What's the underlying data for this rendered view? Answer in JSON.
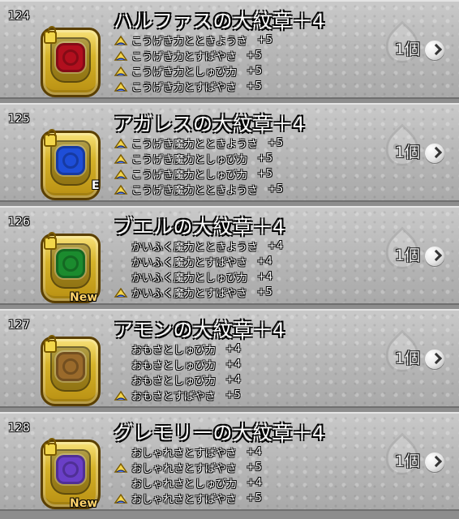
{
  "items": [
    {
      "num": "124",
      "name": "ハルファスの大紋章＋4",
      "qty": "1個",
      "crest_color": "#b10f1e",
      "badge_type": "",
      "stats": [
        {
          "text": "こうげき力とときようさ",
          "bonus": "+5",
          "has_hat": true
        },
        {
          "text": "こうげき力とすばやさ",
          "bonus": "+5",
          "has_hat": true
        },
        {
          "text": "こうげき力としゅび力",
          "bonus": "+5",
          "has_hat": true
        },
        {
          "text": "こうげき力とすばやさ",
          "bonus": "+5",
          "has_hat": true
        }
      ]
    },
    {
      "num": "125",
      "name": "アガレスの大紋章＋4",
      "qty": "1個",
      "crest_color": "#1e4ed8",
      "badge_type": "E",
      "stats": [
        {
          "text": "こうげき魔力とときようさ",
          "bonus": "+5",
          "has_hat": true
        },
        {
          "text": "こうげき魔力としゅび力",
          "bonus": "+5",
          "has_hat": true
        },
        {
          "text": "こうげき魔力としゅび力",
          "bonus": "+5",
          "has_hat": true
        },
        {
          "text": "こうげき魔力とときようさ",
          "bonus": "+5",
          "has_hat": true
        }
      ]
    },
    {
      "num": "126",
      "name": "ブエルの大紋章＋4",
      "qty": "1個",
      "crest_color": "#1b8b2e",
      "badge_type": "New",
      "stats": [
        {
          "text": "かいふく魔力とときようさ",
          "bonus": "+4",
          "has_hat": false
        },
        {
          "text": "かいふく魔力とすばやさ",
          "bonus": "+4",
          "has_hat": false
        },
        {
          "text": "かいふく魔力としゅび力",
          "bonus": "+4",
          "has_hat": false
        },
        {
          "text": "かいふく魔力とすばやさ",
          "bonus": "+5",
          "has_hat": true
        }
      ]
    },
    {
      "num": "127",
      "name": "アモンの大紋章＋4",
      "qty": "1個",
      "crest_color": "#9a6a2b",
      "badge_type": "",
      "stats": [
        {
          "text": "おもさとしゅび力",
          "bonus": "+4",
          "has_hat": false
        },
        {
          "text": "おもさとしゅび力",
          "bonus": "+4",
          "has_hat": false
        },
        {
          "text": "おもさとしゅび力",
          "bonus": "+4",
          "has_hat": false
        },
        {
          "text": "おもさとすばやさ",
          "bonus": "+5",
          "has_hat": true
        }
      ]
    },
    {
      "num": "128",
      "name": "グレモリーの大紋章＋4",
      "qty": "1個",
      "crest_color": "#6a3fc7",
      "badge_type": "New",
      "stats": [
        {
          "text": "おしゃれさとすばやさ",
          "bonus": "+4",
          "has_hat": false
        },
        {
          "text": "おしゃれさとすばやさ",
          "bonus": "+5",
          "has_hat": true
        },
        {
          "text": "おしゃれさとしゅび力",
          "bonus": "+4",
          "has_hat": false
        },
        {
          "text": "おしゃれさとすばやさ",
          "bonus": "+5",
          "has_hat": true
        }
      ]
    }
  ]
}
